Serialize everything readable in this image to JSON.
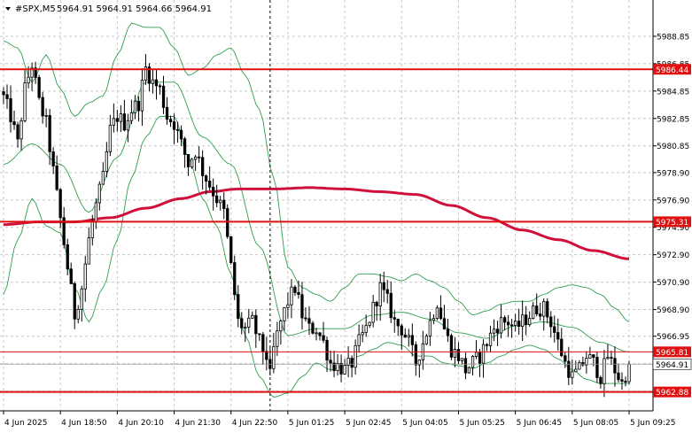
{
  "header": {
    "symbol": "#SPX,M5",
    "ohlc": "5964.91 5964.91 5964.66 5964.91"
  },
  "colors": {
    "background": "#ffffff",
    "grid": "#c8c8c8",
    "candle": "#000000",
    "level_line": "#e01010",
    "ma_line": "#d0103a",
    "bands": "#2e9e4e",
    "price_tag_bg": "#e01010",
    "current_price_bg": "#ffffff"
  },
  "chart_data": {
    "type": "candlestick",
    "y_range": [
      5961.5,
      5991.5
    ],
    "y_ticks": [
      "5988.85",
      "5986.85",
      "5984.85",
      "5982.85",
      "5980.85",
      "5978.90",
      "5976.90",
      "5974.90",
      "5972.90",
      "5970.90",
      "5968.90",
      "5966.95",
      "5964.95",
      "5962.95"
    ],
    "y_tick_values": [
      5988.85,
      5986.85,
      5984.85,
      5982.85,
      5980.85,
      5978.9,
      5976.9,
      5974.9,
      5972.9,
      5970.9,
      5968.9,
      5966.95,
      5964.95,
      5962.95
    ],
    "x_ticks": [
      "4 Jun 2025",
      "4 Jun 18:50",
      "4 Jun 20:10",
      "4 Jun 21:30",
      "4 Jun 22:50",
      "5 Jun 01:25",
      "5 Jun 02:45",
      "5 Jun 04:05",
      "5 Jun 05:25",
      "5 Jun 06:45",
      "5 Jun 08:05",
      "5 Jun 09:25"
    ],
    "x_tick_bars": [
      0,
      16,
      32,
      48,
      64,
      80,
      96,
      112,
      128,
      144,
      160,
      176
    ],
    "levels": [
      {
        "label": "5986.44",
        "value": 5986.44,
        "style": "thick"
      },
      {
        "label": "5975.31",
        "value": 5975.31,
        "style": "thick"
      },
      {
        "label": "5965.81",
        "value": 5965.81,
        "style": "thin"
      },
      {
        "label": "5962.88",
        "value": 5962.88,
        "style": "thick"
      }
    ],
    "current_price": {
      "label": "5964.91",
      "value": 5964.91
    },
    "crosshair_bar": 75,
    "candle_count": 177,
    "close_anchors": [
      [
        0,
        5984.4
      ],
      [
        2,
        5983.0
      ],
      [
        4,
        5981.0
      ],
      [
        6,
        5985.0
      ],
      [
        8,
        5986.8
      ],
      [
        10,
        5984.0
      ],
      [
        12,
        5982.5
      ],
      [
        14,
        5979.0
      ],
      [
        16,
        5975.5
      ],
      [
        18,
        5972.0
      ],
      [
        20,
        5968.5
      ],
      [
        22,
        5970.5
      ],
      [
        24,
        5974.0
      ],
      [
        26,
        5976.5
      ],
      [
        28,
        5978.5
      ],
      [
        30,
        5982.0
      ],
      [
        32,
        5983.0
      ],
      [
        34,
        5982.5
      ],
      [
        36,
        5983.5
      ],
      [
        38,
        5984.0
      ],
      [
        40,
        5986.5
      ],
      [
        42,
        5985.5
      ],
      [
        44,
        5985.0
      ],
      [
        46,
        5983.0
      ],
      [
        48,
        5982.5
      ],
      [
        50,
        5981.0
      ],
      [
        52,
        5979.5
      ],
      [
        54,
        5980.5
      ],
      [
        56,
        5979.0
      ],
      [
        58,
        5978.0
      ],
      [
        60,
        5977.0
      ],
      [
        62,
        5976.0
      ],
      [
        64,
        5972.0
      ],
      [
        66,
        5968.0
      ],
      [
        68,
        5967.5
      ],
      [
        70,
        5968.0
      ],
      [
        72,
        5966.5
      ],
      [
        74,
        5965.5
      ],
      [
        75,
        5964.0
      ],
      [
        76,
        5966.0
      ],
      [
        78,
        5968.0
      ],
      [
        80,
        5969.5
      ],
      [
        82,
        5970.5
      ],
      [
        84,
        5968.5
      ],
      [
        86,
        5967.5
      ],
      [
        88,
        5967.5
      ],
      [
        90,
        5966.5
      ],
      [
        92,
        5965.0
      ],
      [
        94,
        5964.8
      ],
      [
        96,
        5964.5
      ],
      [
        98,
        5965.0
      ],
      [
        100,
        5966.5
      ],
      [
        102,
        5967.5
      ],
      [
        104,
        5969.0
      ],
      [
        106,
        5970.5
      ],
      [
        108,
        5969.5
      ],
      [
        110,
        5968.0
      ],
      [
        112,
        5967.5
      ],
      [
        114,
        5966.5
      ],
      [
        116,
        5965.0
      ],
      [
        118,
        5966.5
      ],
      [
        120,
        5968.0
      ],
      [
        122,
        5969.5
      ],
      [
        124,
        5967.5
      ],
      [
        126,
        5966.0
      ],
      [
        128,
        5965.5
      ],
      [
        130,
        5964.5
      ],
      [
        132,
        5965.0
      ],
      [
        134,
        5965.5
      ],
      [
        136,
        5966.5
      ],
      [
        138,
        5967.5
      ],
      [
        140,
        5968.0
      ],
      [
        142,
        5968.0
      ],
      [
        144,
        5967.5
      ],
      [
        146,
        5968.0
      ],
      [
        148,
        5968.5
      ],
      [
        150,
        5969.0
      ],
      [
        152,
        5969.0
      ],
      [
        154,
        5968.0
      ],
      [
        156,
        5966.5
      ],
      [
        158,
        5965.0
      ],
      [
        160,
        5964.0
      ],
      [
        162,
        5964.5
      ],
      [
        164,
        5965.5
      ],
      [
        166,
        5965.0
      ],
      [
        168,
        5964.0
      ],
      [
        170,
        5965.5
      ],
      [
        172,
        5964.5
      ],
      [
        174,
        5963.5
      ],
      [
        176,
        5964.91
      ]
    ],
    "ma_anchors": [
      [
        0,
        5975.1
      ],
      [
        10,
        5975.3
      ],
      [
        20,
        5975.3
      ],
      [
        30,
        5975.6
      ],
      [
        40,
        5976.3
      ],
      [
        50,
        5977.0
      ],
      [
        58,
        5977.5
      ],
      [
        66,
        5977.7
      ],
      [
        76,
        5977.7
      ],
      [
        86,
        5977.8
      ],
      [
        96,
        5977.7
      ],
      [
        106,
        5977.5
      ],
      [
        116,
        5977.3
      ],
      [
        126,
        5976.5
      ],
      [
        136,
        5975.6
      ],
      [
        146,
        5974.7
      ],
      [
        156,
        5974.0
      ],
      [
        166,
        5973.2
      ],
      [
        176,
        5972.6
      ]
    ],
    "upper_band_anchors": [
      [
        0,
        5988.5
      ],
      [
        4,
        5988.0
      ],
      [
        8,
        5985.5
      ],
      [
        12,
        5987.5
      ],
      [
        16,
        5985.0
      ],
      [
        20,
        5983.0
      ],
      [
        24,
        5984.0
      ],
      [
        28,
        5984.5
      ],
      [
        32,
        5987.5
      ],
      [
        36,
        5989.8
      ],
      [
        40,
        5989.5
      ],
      [
        44,
        5989.5
      ],
      [
        48,
        5988.0
      ],
      [
        52,
        5986.0
      ],
      [
        56,
        5986.5
      ],
      [
        60,
        5987.5
      ],
      [
        64,
        5988.0
      ],
      [
        68,
        5986.0
      ],
      [
        72,
        5983.5
      ],
      [
        76,
        5978.5
      ],
      [
        80,
        5972.0
      ],
      [
        84,
        5970.5
      ],
      [
        88,
        5970.0
      ],
      [
        92,
        5969.5
      ],
      [
        96,
        5970.5
      ],
      [
        100,
        5971.5
      ],
      [
        104,
        5971.5
      ],
      [
        108,
        5971.3
      ],
      [
        112,
        5971.0
      ],
      [
        116,
        5971.5
      ],
      [
        120,
        5971.0
      ],
      [
        124,
        5970.5
      ],
      [
        128,
        5969.5
      ],
      [
        132,
        5968.5
      ],
      [
        136,
        5968.8
      ],
      [
        140,
        5969.3
      ],
      [
        144,
        5969.5
      ],
      [
        148,
        5969.5
      ],
      [
        152,
        5970.0
      ],
      [
        156,
        5970.5
      ],
      [
        160,
        5970.7
      ],
      [
        164,
        5970.5
      ],
      [
        168,
        5970.0
      ],
      [
        172,
        5969.0
      ],
      [
        176,
        5968.0
      ]
    ],
    "lower_band_anchors": [
      [
        0,
        5970.0
      ],
      [
        4,
        5974.0
      ],
      [
        8,
        5977.0
      ],
      [
        12,
        5975.0
      ],
      [
        16,
        5974.5
      ],
      [
        20,
        5970.5
      ],
      [
        24,
        5968.0
      ],
      [
        28,
        5970.5
      ],
      [
        32,
        5974.0
      ],
      [
        36,
        5978.5
      ],
      [
        40,
        5981.5
      ],
      [
        44,
        5983.0
      ],
      [
        48,
        5983.0
      ],
      [
        52,
        5980.0
      ],
      [
        56,
        5977.0
      ],
      [
        60,
        5975.0
      ],
      [
        64,
        5971.5
      ],
      [
        68,
        5967.0
      ],
      [
        72,
        5964.0
      ],
      [
        76,
        5962.5
      ],
      [
        80,
        5962.8
      ],
      [
        84,
        5964.0
      ],
      [
        88,
        5965.0
      ],
      [
        92,
        5964.5
      ],
      [
        96,
        5964.8
      ],
      [
        100,
        5965.5
      ],
      [
        104,
        5966.0
      ],
      [
        108,
        5966.5
      ],
      [
        112,
        5966.3
      ],
      [
        116,
        5965.5
      ],
      [
        120,
        5965.5
      ],
      [
        124,
        5965.0
      ],
      [
        128,
        5964.8
      ],
      [
        132,
        5964.6
      ],
      [
        136,
        5965.0
      ],
      [
        140,
        5965.5
      ],
      [
        144,
        5966.0
      ],
      [
        148,
        5966.3
      ],
      [
        152,
        5966.0
      ],
      [
        156,
        5965.3
      ],
      [
        160,
        5964.5
      ],
      [
        164,
        5963.8
      ],
      [
        168,
        5963.5
      ],
      [
        172,
        5963.5
      ],
      [
        176,
        5963.5
      ]
    ],
    "mid_band_anchors": [
      [
        0,
        5979.5
      ],
      [
        8,
        5981.0
      ],
      [
        16,
        5979.5
      ],
      [
        24,
        5976.0
      ],
      [
        32,
        5980.0
      ],
      [
        40,
        5985.5
      ],
      [
        48,
        5985.5
      ],
      [
        56,
        5981.5
      ],
      [
        64,
        5979.5
      ],
      [
        72,
        5973.5
      ],
      [
        80,
        5967.0
      ],
      [
        88,
        5967.5
      ],
      [
        96,
        5967.5
      ],
      [
        104,
        5968.5
      ],
      [
        112,
        5968.7
      ],
      [
        120,
        5968.2
      ],
      [
        128,
        5967.2
      ],
      [
        136,
        5966.8
      ],
      [
        144,
        5967.7
      ],
      [
        152,
        5968.0
      ],
      [
        160,
        5967.6
      ],
      [
        168,
        5966.5
      ],
      [
        176,
        5965.8
      ]
    ]
  }
}
